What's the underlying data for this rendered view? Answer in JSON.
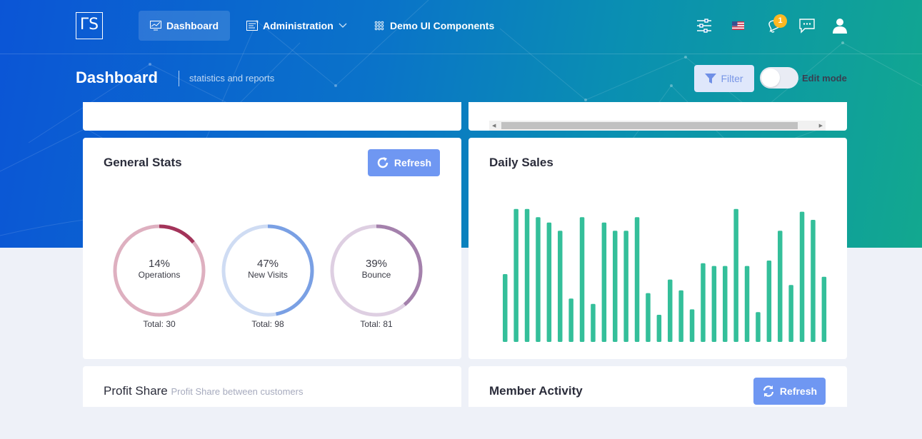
{
  "brand": {
    "logo_text": "ΓS"
  },
  "nav": {
    "items": [
      {
        "label": "Dashboard",
        "icon": "chart-line-icon",
        "active": true
      },
      {
        "label": "Administration",
        "icon": "admin-icon",
        "has_dropdown": true
      },
      {
        "label": "Demo UI Components",
        "icon": "grid-dots-icon"
      }
    ]
  },
  "topbar": {
    "icons": [
      "settings-sliders-icon",
      "flag-us-icon",
      "bell-icon",
      "chat-icon",
      "user-icon"
    ],
    "notification_count": "1"
  },
  "header": {
    "title": "Dashboard",
    "subtitle": "statistics and reports",
    "filter_label": "Filter",
    "edit_mode_label": "Edit mode",
    "edit_mode_on": false
  },
  "general_stats": {
    "title": "General Stats",
    "refresh_label": "Refresh",
    "donuts": [
      {
        "percent_text": "14%",
        "percent": 14,
        "label": "Operations",
        "total": "Total: 30",
        "color": "#a3345a",
        "track": "#deb0c0"
      },
      {
        "percent_text": "47%",
        "percent": 47,
        "label": "New Visits",
        "total": "Total: 98",
        "color": "#7aa0e4",
        "track": "#cfdcf3"
      },
      {
        "percent_text": "39%",
        "percent": 39,
        "label": "Bounce",
        "total": "Total: 81",
        "color": "#a481ac",
        "track": "#decfe2"
      }
    ]
  },
  "daily_sales": {
    "title": "Daily Sales",
    "bar_color": "#34bf9a"
  },
  "chart_data": {
    "type": "bar",
    "title": "Daily Sales",
    "values": [
      50,
      98,
      98,
      92,
      88,
      82,
      32,
      92,
      28,
      88,
      82,
      82,
      92,
      36,
      20,
      46,
      38,
      24,
      58,
      56,
      56,
      98,
      56,
      22,
      60,
      82,
      42,
      96,
      90,
      48
    ]
  },
  "profit_share": {
    "title": "Profit Share",
    "subtitle": "Profit Share between customers"
  },
  "member_activity": {
    "title": "Member Activity",
    "refresh_label": "Refresh"
  }
}
